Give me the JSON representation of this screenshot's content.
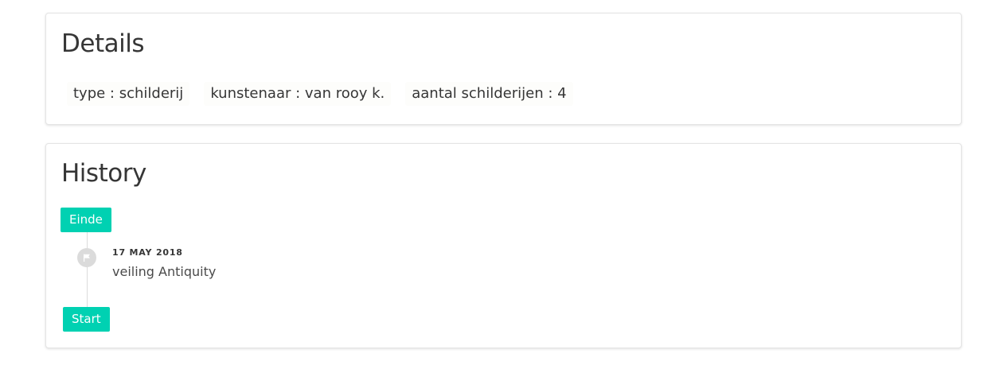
{
  "details": {
    "title": "Details",
    "items": [
      {
        "text": "type : schilderij"
      },
      {
        "text": "kunstenaar : van rooy k."
      },
      {
        "text": "aantal schilderijen : 4"
      }
    ]
  },
  "history": {
    "title": "History",
    "end_label": "Einde",
    "start_label": "Start",
    "events": [
      {
        "date": "17 MAY 2018",
        "description": "veiling Antiquity",
        "icon": "flag-icon"
      }
    ]
  },
  "colors": {
    "accent": "#00d1b2",
    "marker": "#dbdbdb"
  }
}
